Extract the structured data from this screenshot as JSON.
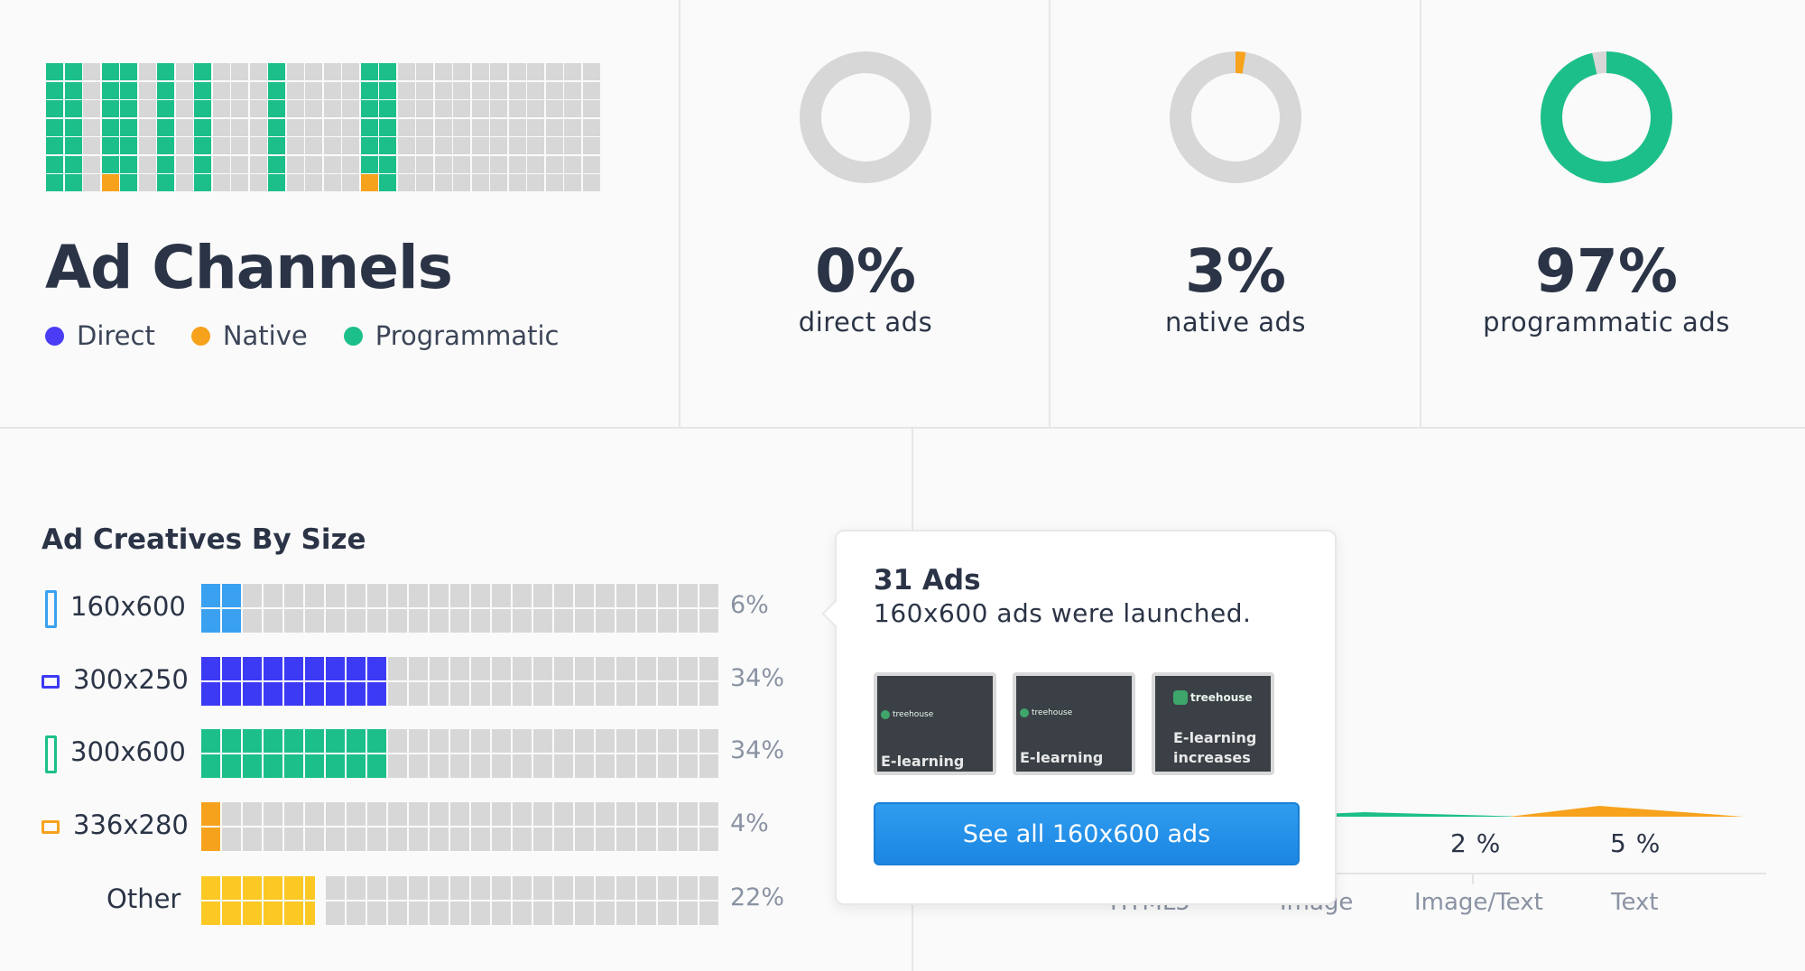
{
  "ad_channels": {
    "title": "Ad Channels",
    "legend": [
      {
        "label": "Direct",
        "color": "#4a3df5"
      },
      {
        "label": "Native",
        "color": "#f7a21c"
      },
      {
        "label": "Programmatic",
        "color": "#1cbf8a"
      }
    ],
    "waffle": {
      "columns": 30,
      "rows": 7,
      "green_columns": [
        0,
        1,
        3,
        4,
        6,
        8,
        12,
        17,
        18
      ],
      "orange_cells": [
        [
          3,
          6
        ],
        [
          17,
          6
        ]
      ]
    }
  },
  "stats": [
    {
      "pct": "0%",
      "label": "direct ads",
      "value": 0,
      "color": "#4a3df5"
    },
    {
      "pct": "3%",
      "label": "native ads",
      "value": 3,
      "color": "#f7a21c"
    },
    {
      "pct": "97%",
      "label": "programmatic ads",
      "value": 97,
      "color": "#1cbf8a"
    }
  ],
  "creatives": {
    "title": "Ad Creatives By Size",
    "rows": [
      {
        "label": "160x600",
        "pct": "6%",
        "filled": 2,
        "color": "#3aa1f0",
        "icon": "vertical"
      },
      {
        "label": "300x250",
        "pct": "34%",
        "filled": 9,
        "color": "#3d3af5",
        "icon": "horizontal"
      },
      {
        "label": "300x600",
        "pct": "34%",
        "filled": 9,
        "color": "#1cbf8a",
        "icon": "vertical"
      },
      {
        "label": "336x280",
        "pct": "4%",
        "filled": 1,
        "color": "#f7a21c",
        "icon": "horizontal"
      },
      {
        "label": "Other",
        "pct": "22%",
        "filled": 5.5,
        "color": "#fcc824",
        "icon": "none"
      }
    ]
  },
  "tooltip": {
    "title": "31 Ads",
    "subtitle": "160x600 ads were launched.",
    "thumbs": [
      {
        "brand": "treehouse",
        "caption": "E-learning"
      },
      {
        "brand": "treehouse",
        "caption": "E-learning"
      },
      {
        "brand": "treehouse",
        "caption": "E-learning increases"
      }
    ],
    "button": "See all 160x600 ads"
  },
  "chart_data": {
    "type": "area",
    "categories": [
      "HTML5",
      "Image",
      "Image/Text",
      "Text"
    ],
    "value_labels": [
      "",
      "",
      "2 %",
      "5 %"
    ],
    "x_tick_labels": [
      "HTML5",
      "Image",
      "Image/Text",
      "Text"
    ]
  }
}
